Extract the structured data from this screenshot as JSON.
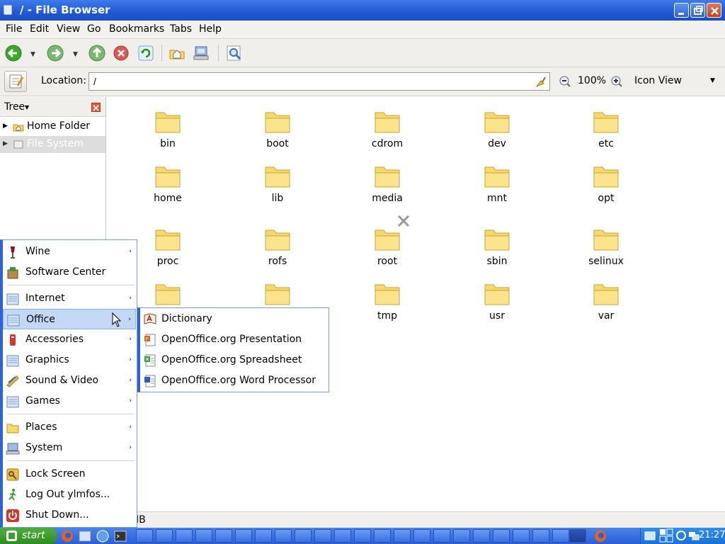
{
  "window": {
    "title": "/ - File Browser"
  },
  "menubar": {
    "items": [
      "File",
      "Edit",
      "View",
      "Go",
      "Bookmarks",
      "Tabs",
      "Help"
    ]
  },
  "location": {
    "label": "Location:",
    "value": "/"
  },
  "zoom": {
    "level": "100%"
  },
  "view": {
    "mode": "Icon View"
  },
  "sidebar": {
    "title": "Tree",
    "items": [
      {
        "label": "Home Folder"
      },
      {
        "label": "File System"
      }
    ]
  },
  "files": [
    "bin",
    "boot",
    "cdrom",
    "dev",
    "etc",
    "home",
    "lib",
    "media",
    "mnt",
    "opt",
    "proc",
    "rofs",
    "root",
    "sbin",
    "selinux",
    "",
    "",
    "tmp",
    "usr",
    "var"
  ],
  "status": {
    "text": "IB"
  },
  "startmenu": {
    "items": [
      {
        "label": "Wine",
        "arrow": "›"
      },
      {
        "label": "Software Center",
        "arrow": ""
      },
      {
        "label": "Internet",
        "arrow": "›"
      },
      {
        "label": "Office",
        "arrow": "›"
      },
      {
        "label": "Accessories",
        "arrow": "›"
      },
      {
        "label": "Graphics",
        "arrow": "›"
      },
      {
        "label": "Sound & Video",
        "arrow": "›"
      },
      {
        "label": "Games",
        "arrow": "›"
      },
      {
        "label": "Places",
        "arrow": "›"
      },
      {
        "label": "System",
        "arrow": "›"
      },
      {
        "label": "Lock Screen",
        "arrow": ""
      },
      {
        "label": "Log Out ylmfos...",
        "arrow": ""
      },
      {
        "label": "Shut Down...",
        "arrow": ""
      }
    ]
  },
  "submenu": {
    "items": [
      {
        "label": "Dictionary"
      },
      {
        "label": "OpenOffice.org Presentation"
      },
      {
        "label": "OpenOffice.org Spreadsheet"
      },
      {
        "label": "OpenOffice.org Word Processor"
      }
    ]
  },
  "taskbar": {
    "start_label": "start",
    "clock": "21:27"
  },
  "icons": {
    "folder": "folder-icon",
    "back": "back-arrow-icon",
    "forward": "forward-arrow-icon",
    "up": "up-arrow-icon",
    "stop": "stop-icon",
    "reload": "reload-icon",
    "home": "home-folder-icon",
    "computer": "computer-icon",
    "search": "search-icon"
  },
  "colors": {
    "titlebar": "#2159d4",
    "folder": "#f6d96b",
    "highlight": "#c2d8f6",
    "taskbar": "#2b5fd4",
    "start": "#3a9f2e"
  }
}
